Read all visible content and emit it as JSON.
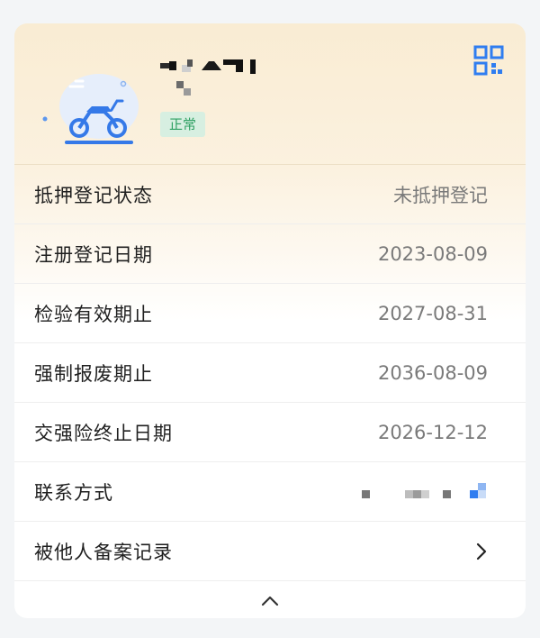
{
  "header": {
    "plate_number": "▪▪◢▀▌",
    "status_badge": "正常",
    "icons": {
      "vehicle": "motorcycle-icon",
      "qr": "qr-code-icon"
    }
  },
  "rows": [
    {
      "label": "抵押登记状态",
      "value": "未抵押登记"
    },
    {
      "label": "注册登记日期",
      "value": "2023-08-09"
    },
    {
      "label": "检验有效期止",
      "value": "2027-08-31"
    },
    {
      "label": "强制报废期止",
      "value": "2036-08-09"
    },
    {
      "label": "交强险终止日期",
      "value": "2026-12-12"
    },
    {
      "label": "联系方式",
      "value": ""
    },
    {
      "label": "被他人备案记录",
      "value": ""
    }
  ],
  "colors": {
    "accent_blue": "#2f7df0",
    "status_green": "#2ea062",
    "status_bg": "#d7efe1"
  }
}
